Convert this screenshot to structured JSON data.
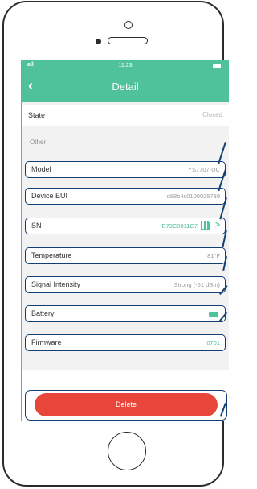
{
  "status_bar": {
    "signal": "all",
    "time": "11:23"
  },
  "nav": {
    "back_icon": "chevron-left-icon",
    "title": "Detail"
  },
  "state": {
    "label": "State",
    "value": "Closed"
  },
  "section_title": "Other",
  "rows": [
    {
      "label": "Model",
      "value": "YS7707-UC"
    },
    {
      "label": "Device EUI",
      "value": "d88b4c0100025739"
    },
    {
      "label": "SN",
      "value": "E73C8811C7",
      "chevron": ">"
    },
    {
      "label": "Temperature",
      "value": "81°F"
    },
    {
      "label": "Signal Intensity",
      "value": "Strong (-61 dBm)"
    },
    {
      "label": "Battery"
    },
    {
      "label": "Firmware",
      "value": "0701"
    }
  ],
  "delete_button": {
    "label": "Delete"
  },
  "colors": {
    "accent": "#4fc29b",
    "danger": "#e8453b",
    "callout": "#123f73"
  }
}
